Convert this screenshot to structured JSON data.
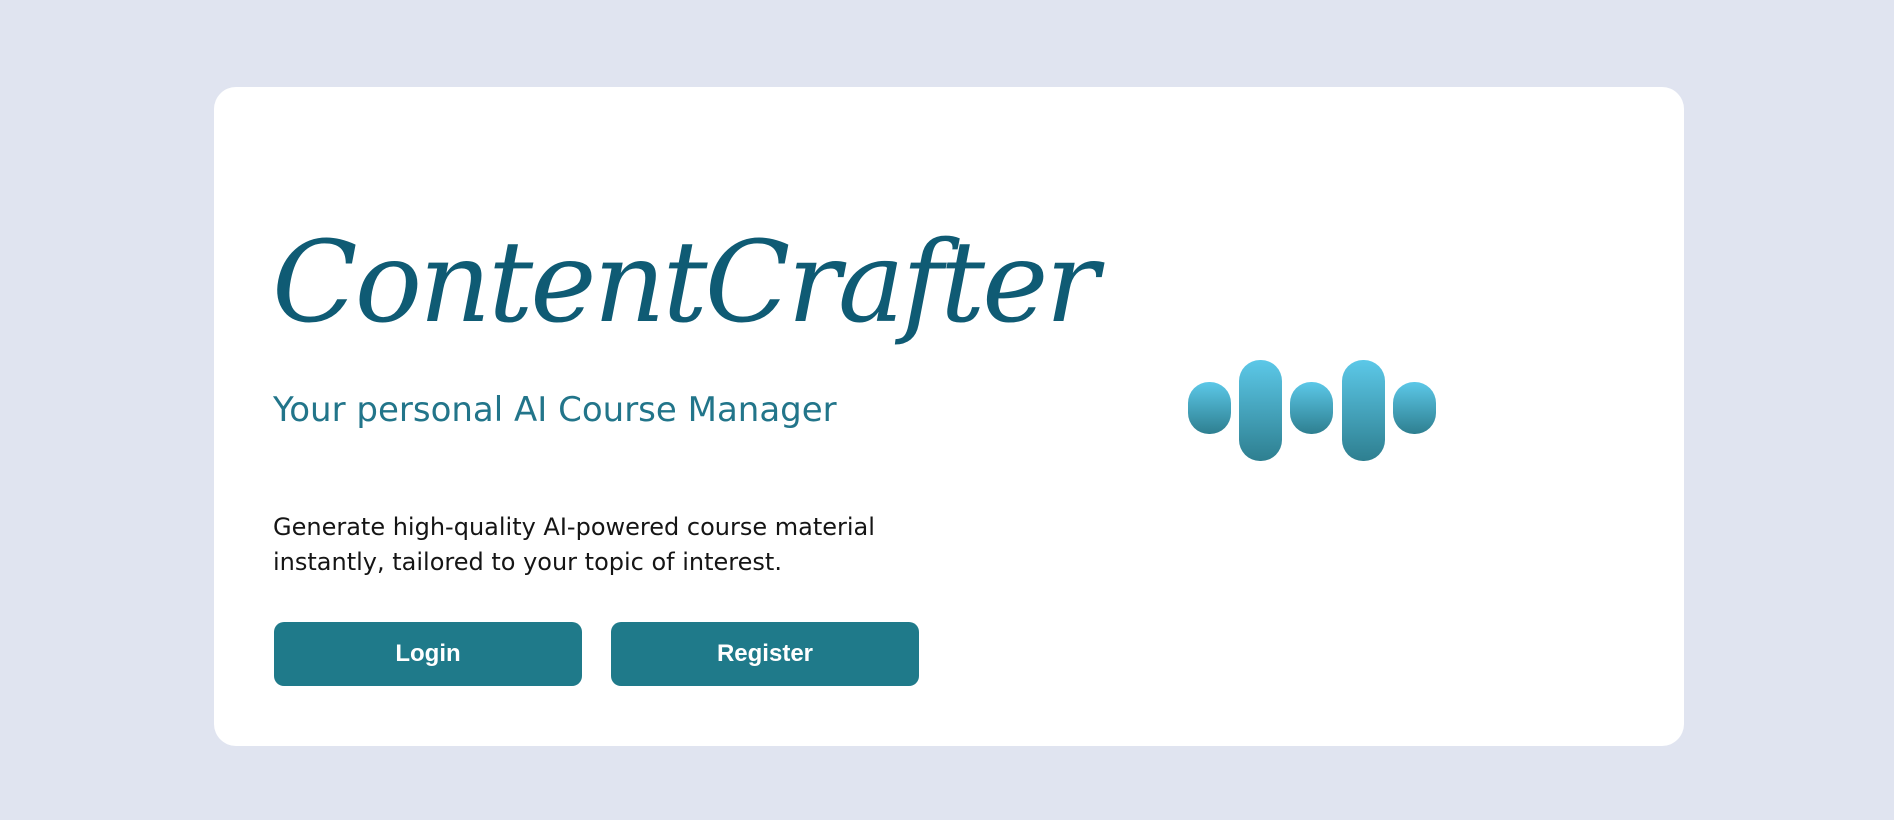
{
  "brand": {
    "name": "ContentCrafter",
    "color": "#0f5b74"
  },
  "hero": {
    "tagline": "Your personal AI Course Manager",
    "description": "Generate high-quality AI-powered course material instantly, tailored to your topic of interest."
  },
  "actions": {
    "login_label": "Login",
    "register_label": "Register",
    "button_color": "#1f7a8a"
  },
  "logo": {
    "icon": "sound-wave-bars-icon",
    "gradient_top": "#5cc8e8",
    "gradient_bottom": "#2e7f90"
  },
  "page": {
    "background": "#e0e4f0"
  }
}
